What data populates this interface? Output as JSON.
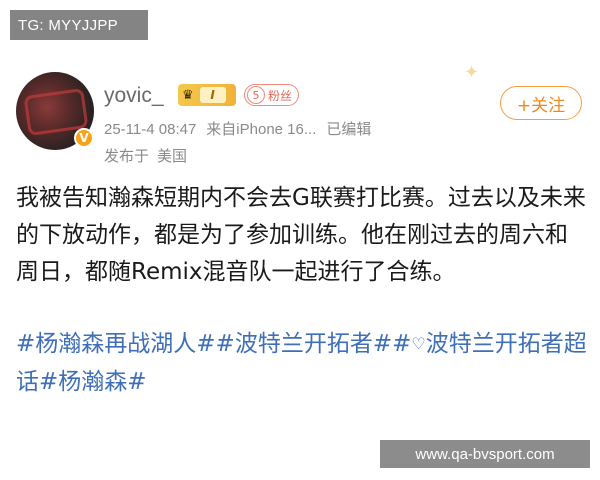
{
  "watermarks": {
    "top": "TG: MYYJJPP",
    "bottom": "www.qa-bvsport.com"
  },
  "post": {
    "author": {
      "username": "yovic_",
      "level": "I",
      "tag_number": "5",
      "tag_text": "粉丝"
    },
    "meta": {
      "date": "25-11-4 08:47",
      "source": "来自iPhone 16...",
      "edited": "已编辑"
    },
    "location": {
      "prefix": "发布于",
      "place": "美国"
    },
    "follow_label": "+关注",
    "body": "我被告知瀚森短期内不会去G联赛打比赛。过去以及未来的下放动作，都是为了参加训练。他在刚过去的周六和周日，都随Remix混音队一起进行了合练。",
    "topics": {
      "t1": "#杨瀚森再战湖人#",
      "t2": "#波特兰开拓者#",
      "t3": "波特兰开拓者超话",
      "t4": "#杨瀚森#"
    }
  },
  "colors": {
    "follow_accent": "#ee8a1a",
    "topic_link": "#3f6fb8",
    "meta_gray": "#8a8a8a"
  },
  "icons": [
    "crown-icon",
    "verified-icon",
    "diamond-icon"
  ]
}
